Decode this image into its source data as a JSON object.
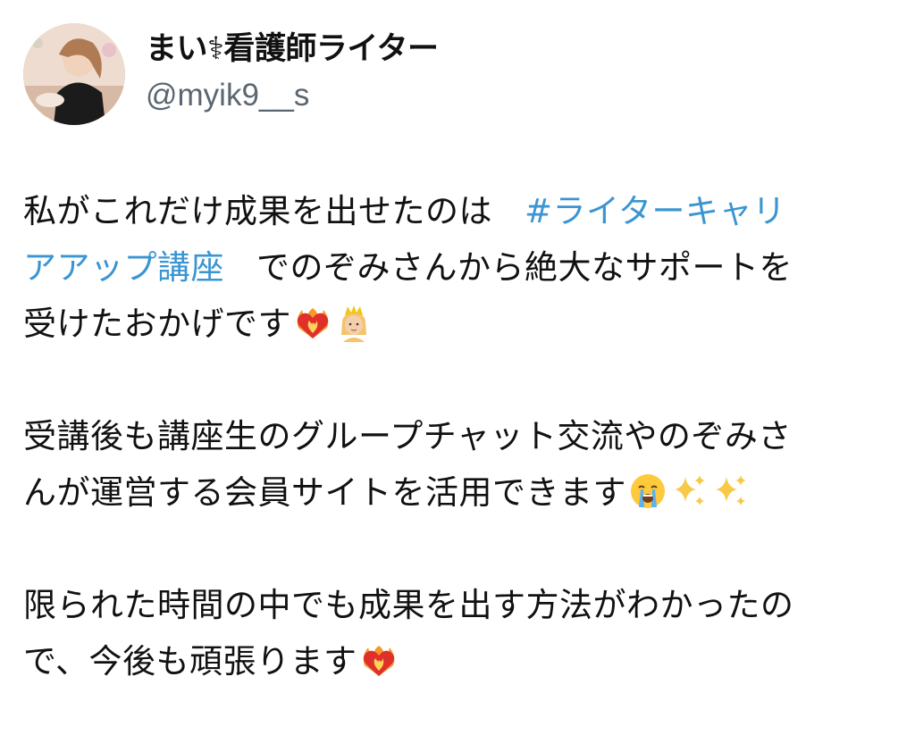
{
  "user": {
    "display_name": "まい⚕看護師ライター",
    "handle": "@myik9__s"
  },
  "tweet": {
    "p1": {
      "l1_text": "私がこれだけ成果を出せたのは",
      "hashtag_part1": "#ライターキャリ",
      "hashtag_part2": "アアップ講座",
      "l2_text": "でのぞみさんから絶大なサポートを",
      "l3_text": "受けたおかげです"
    },
    "p2": {
      "l1_text": "受講後も講座生のグループチャット交流やのぞみさ",
      "l2_text": "んが運営する会員サイトを活用できます"
    },
    "p3": {
      "l1_text": "限られた時間の中でも成果を出す方法がわかったの",
      "l2_text": "で、今後も頑張ります"
    }
  },
  "icons": {
    "p1_emojis": [
      "burning-heart-icon",
      "princess-icon"
    ],
    "p2_emojis": [
      "crying-face-icon",
      "sparkles-icon",
      "sparkles-icon"
    ],
    "p3_emojis": [
      "burning-heart-icon"
    ]
  },
  "colors": {
    "hashtag": "#3b95d3",
    "handle": "#5b6670",
    "text": "#111111",
    "background": "#ffffff"
  }
}
